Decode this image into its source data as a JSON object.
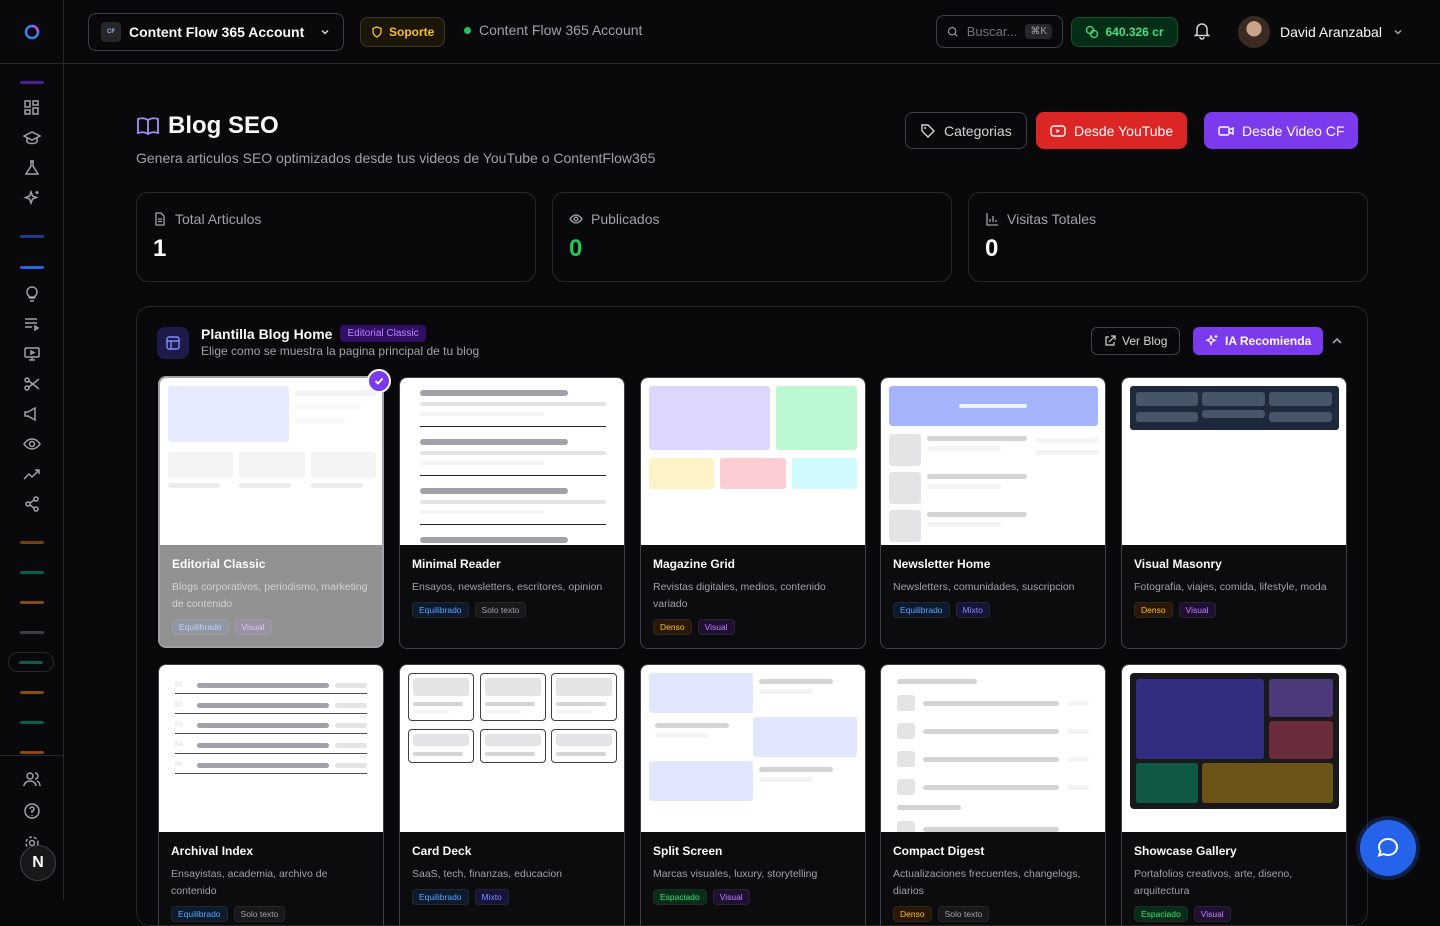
{
  "topbar": {
    "account_name": "Content Flow 365 Account",
    "account_logo": "CF",
    "support_label": "Soporte",
    "account_status": "Content Flow 365 Account",
    "search_placeholder": "Buscar...",
    "search_shortcut": "⌘K",
    "credits": "640.326 cr",
    "user_name": "David Aranzabal"
  },
  "page": {
    "title": "Blog SEO",
    "subtitle": "Genera articulos SEO optimizados desde tus videos de YouTube o ContentFlow365",
    "btn_categories": "Categorias",
    "btn_youtube": "Desde YouTube",
    "btn_video_cf": "Desde Video CF"
  },
  "stats": [
    {
      "label": "Total Articulos",
      "value": "1",
      "color": "#fafafa"
    },
    {
      "label": "Publicados",
      "value": "0",
      "color": "#22c55e"
    },
    {
      "label": "Visitas Totales",
      "value": "0",
      "color": "#fafafa"
    }
  ],
  "panel": {
    "title": "Plantilla Blog Home",
    "badge": "Editorial Classic",
    "subtitle": "Elige como se muestra la pagina principal de tu blog",
    "ver_blog": "Ver Blog",
    "ia_recomienda": "IA Recomienda"
  },
  "templates": [
    {
      "name": "Editorial Classic",
      "desc": "Blogs corporativos, periodismo, marketing de contenido",
      "tags": [
        "Equilibrado",
        "Visual"
      ],
      "selected": true
    },
    {
      "name": "Minimal Reader",
      "desc": "Ensayos, newsletters, escritores, opinion",
      "tags": [
        "Equilibrado",
        "Solo texto"
      ]
    },
    {
      "name": "Magazine Grid",
      "desc": "Revistas digitales, medios, contenido variado",
      "tags": [
        "Denso",
        "Visual"
      ]
    },
    {
      "name": "Newsletter Home",
      "desc": "Newsletters, comunidades, suscripcion",
      "tags": [
        "Equilibrado",
        "Mixto"
      ]
    },
    {
      "name": "Visual Masonry",
      "desc": "Fotografia, viajes, comida, lifestyle, moda",
      "tags": [
        "Denso",
        "Visual"
      ]
    },
    {
      "name": "Archival Index",
      "desc": "Ensayistas, academia, archivo de contenido",
      "tags": [
        "Equilibrado",
        "Solo texto"
      ]
    },
    {
      "name": "Card Deck",
      "desc": "SaaS, tech, finanzas, educacion",
      "tags": [
        "Equilibrado",
        "Mixto"
      ]
    },
    {
      "name": "Split Screen",
      "desc": "Marcas visuales, luxury, storytelling",
      "tags": [
        "Espaciado",
        "Visual"
      ]
    },
    {
      "name": "Compact Digest",
      "desc": "Actualizaciones frecuentes, changelogs, diarios",
      "tags": [
        "Denso",
        "Solo texto"
      ]
    },
    {
      "name": "Showcase Gallery",
      "desc": "Portafolios creativos, arte, diseno, arquitectura",
      "tags": [
        "Espaciado",
        "Visual"
      ]
    }
  ],
  "archival_numbers": [
    "01",
    "02",
    "03",
    "04",
    "05"
  ],
  "nav_letter": "N",
  "colors": {
    "accent": "#7c3aed",
    "youtube": "#dc2626",
    "success": "#22c55e",
    "chat": "#2563eb"
  }
}
